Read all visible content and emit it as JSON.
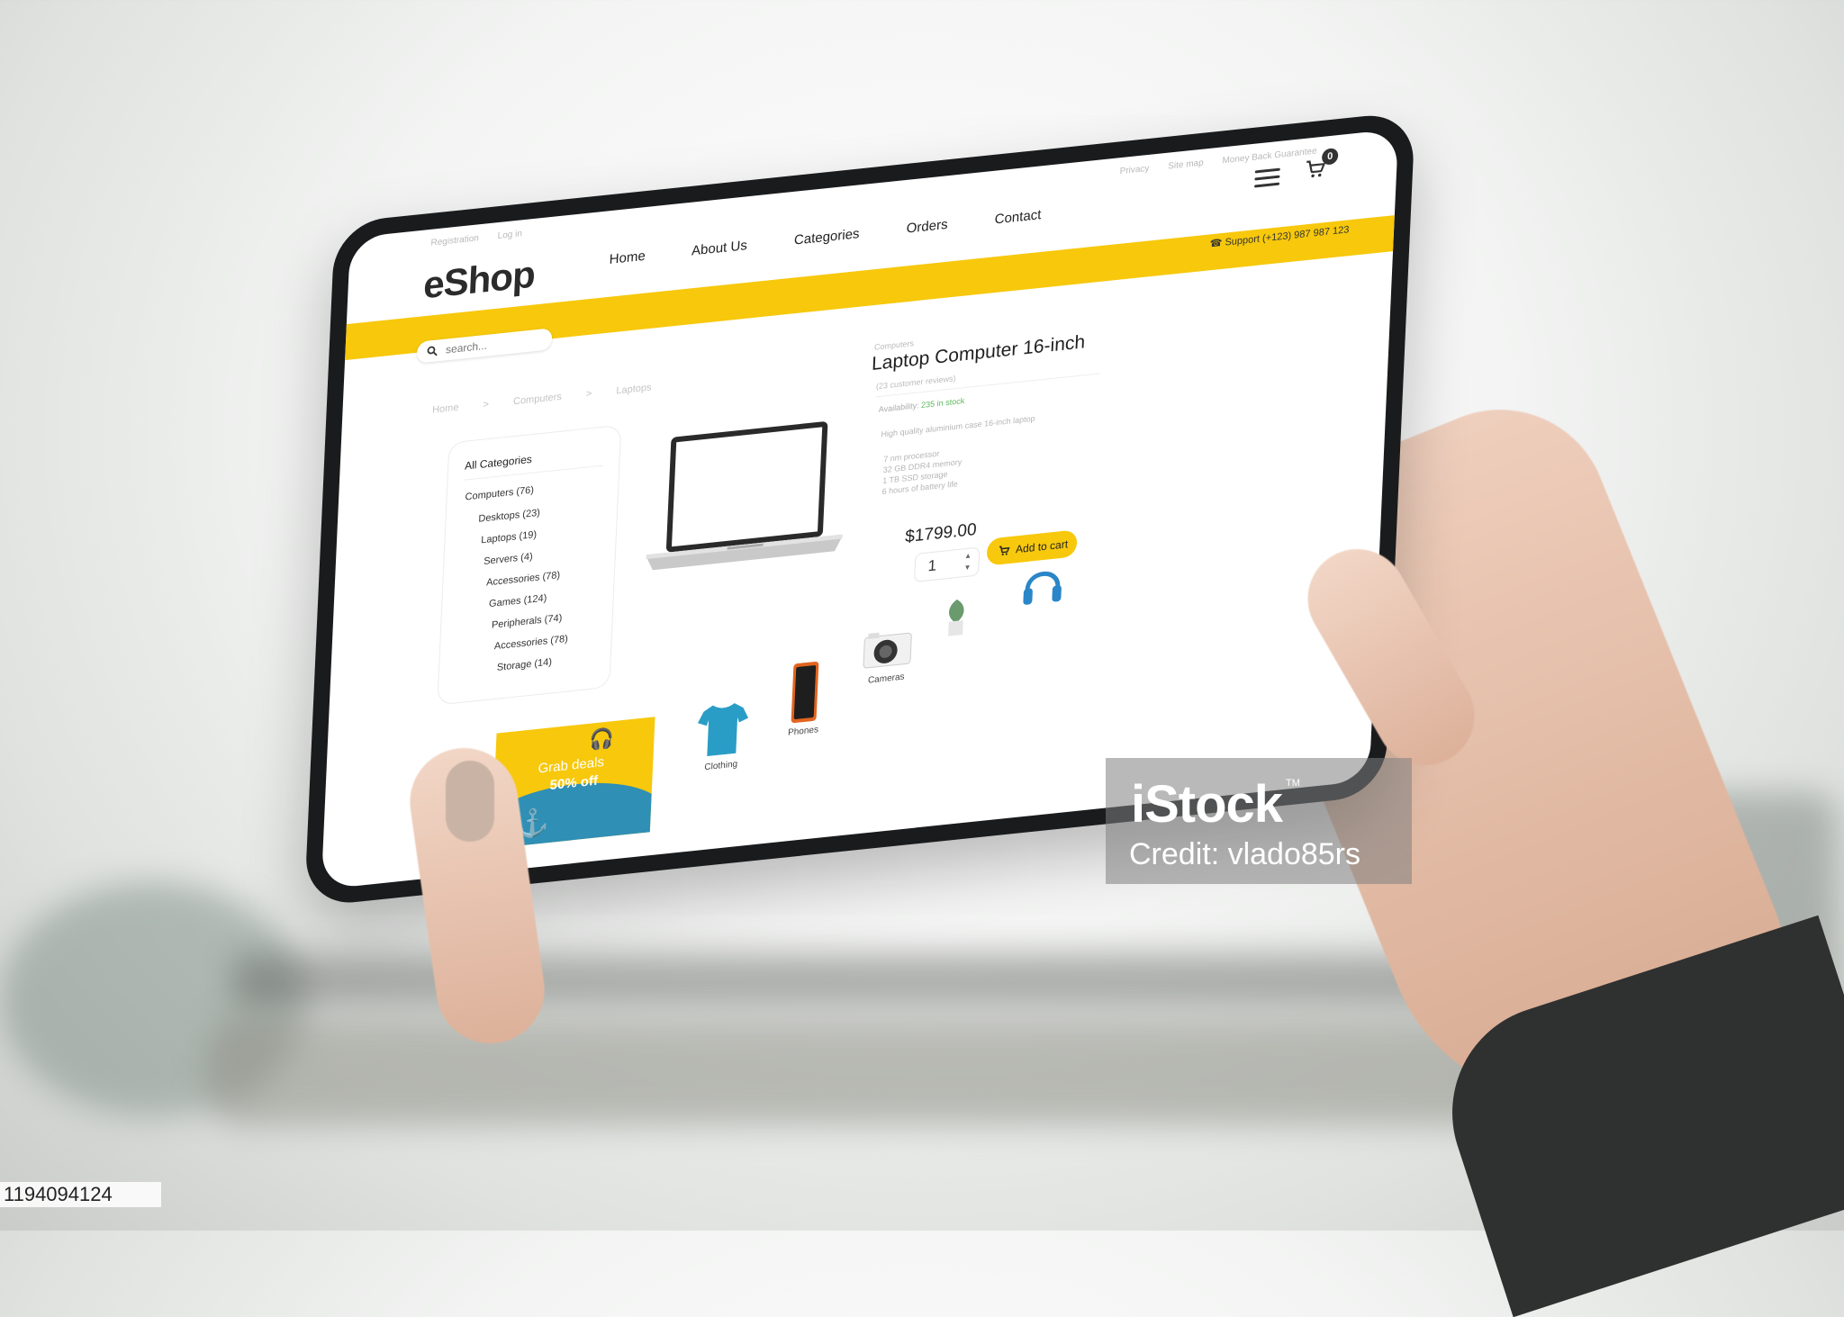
{
  "header": {
    "top_left_links": [
      "Registration",
      "Log in"
    ],
    "top_right_links": [
      "Privacy",
      "Site map",
      "Money Back Guarantee"
    ],
    "logo": "eShop",
    "nav": [
      "Home",
      "About Us",
      "Categories",
      "Orders",
      "Contact"
    ],
    "cart_count": "0",
    "support": "Support (+123) 987 987 123",
    "search_placeholder": "search..."
  },
  "breadcrumb": [
    "Home",
    ">",
    "Computers",
    ">",
    "Laptops"
  ],
  "sidebar": {
    "title": "All Categories",
    "items": [
      {
        "label": "Computers (76)"
      },
      {
        "label": "Desktops (23)"
      },
      {
        "label": "Laptops (19)"
      },
      {
        "label": "Servers (4)"
      },
      {
        "label": "Accessories (78)"
      },
      {
        "label": "Games (124)"
      },
      {
        "label": "Peripherals (74)"
      },
      {
        "label": "Accessories (78)"
      },
      {
        "label": "Storage (14)"
      }
    ]
  },
  "product": {
    "category": "Computers",
    "title": "Laptop Computer 16-inch",
    "reviews": "(23 customer reviews)",
    "availability_label": "Availability:",
    "availability_value": "235 in stock",
    "description": "High quality aluminium case 16-inch laptop",
    "specs": [
      "7 nm processor",
      "32 GB DDR4 memory",
      "1 TB SSD storage",
      "6 hours of battery life"
    ],
    "price": "$1799.00",
    "quantity": "1",
    "add_to_cart": "Add to cart"
  },
  "promo": {
    "line1": "Grab deals",
    "line2": "50% off"
  },
  "categories_row": [
    "Clothing",
    "Phones",
    "Cameras"
  ],
  "watermark": {
    "brand": "iStock",
    "tm": "TM",
    "credit": "Credit: vlado85rs"
  },
  "image_id": "1194094124",
  "colors": {
    "accent": "#f7c80c",
    "promo_wave": "#2f8fb5",
    "in_stock": "#5cb85c"
  }
}
